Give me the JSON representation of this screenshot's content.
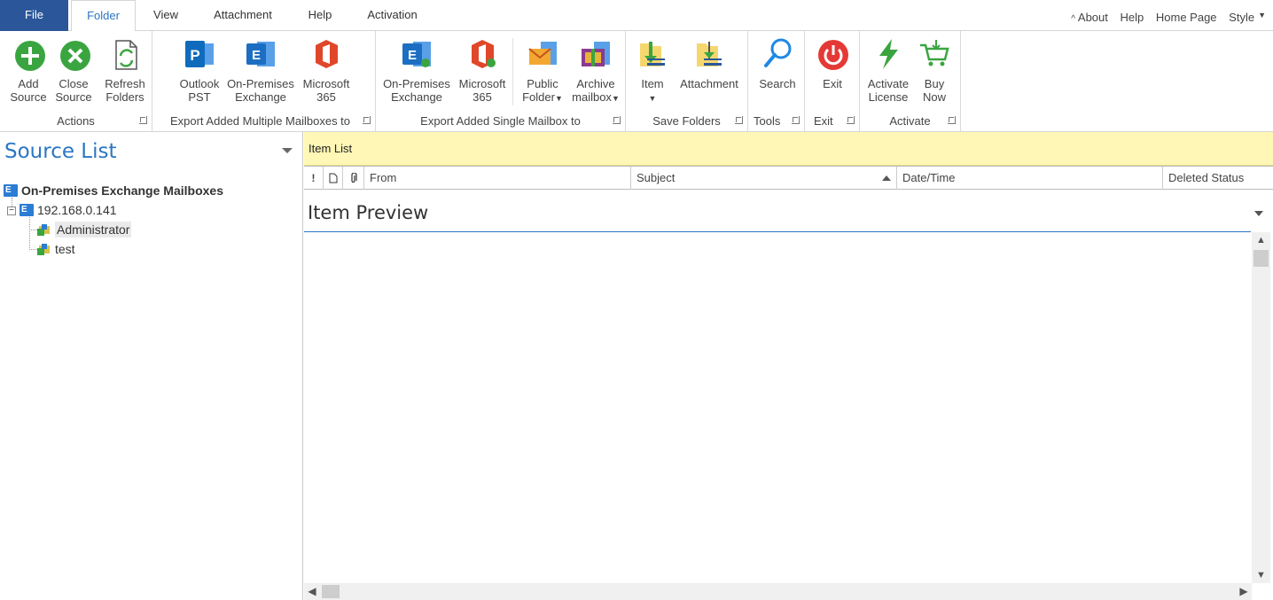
{
  "menu": {
    "tabs": [
      "File",
      "Folder",
      "View",
      "Attachment",
      "Help",
      "Activation"
    ],
    "active_tab": "Folder",
    "right_links": [
      "About",
      "Help",
      "Home Page",
      "Style"
    ]
  },
  "ribbon": {
    "actions": {
      "label": "Actions",
      "add_source": [
        "Add",
        "Source"
      ],
      "close_source": [
        "Close",
        "Source"
      ],
      "refresh_folders": [
        "Refresh",
        "Folders"
      ]
    },
    "export_multiple": {
      "label": "Export Added Multiple Mailboxes to",
      "outlook_pst": [
        "Outlook",
        "PST"
      ],
      "on_prem_exchange": [
        "On-Premises",
        "Exchange"
      ],
      "microsoft_365": [
        "Microsoft",
        "365"
      ]
    },
    "export_single": {
      "label": "Export Added Single Mailbox to",
      "on_prem_exchange": [
        "On-Premises",
        "Exchange"
      ],
      "microsoft_365": [
        "Microsoft",
        "365"
      ],
      "public_folder": [
        "Public",
        "Folder"
      ],
      "archive_mailbox": [
        "Archive",
        "mailbox"
      ]
    },
    "save_folders": {
      "label": "Save Folders",
      "item": "Item",
      "attachment": "Attachment"
    },
    "tools": {
      "label": "Tools",
      "search": "Search"
    },
    "exit": {
      "label": "Exit",
      "exit": "Exit"
    },
    "activate": {
      "label": "Activate",
      "activate_license": [
        "Activate",
        "License"
      ],
      "buy_now": [
        "Buy",
        "Now"
      ]
    }
  },
  "source_list": {
    "title": "Source List",
    "root": "On-Premises Exchange Mailboxes",
    "server": "192.168.0.141",
    "mailboxes": [
      "Administrator",
      "test"
    ],
    "selected": "Administrator"
  },
  "item_list": {
    "title": "Item List",
    "columns": [
      "!",
      "From",
      "Subject",
      "Date/Time",
      "Deleted Status"
    ]
  },
  "item_preview": {
    "title": "Item Preview"
  },
  "colors": {
    "file_tab": "#2b579a",
    "accent": "#2b76c2",
    "item_list_bar": "#fff7b5"
  }
}
